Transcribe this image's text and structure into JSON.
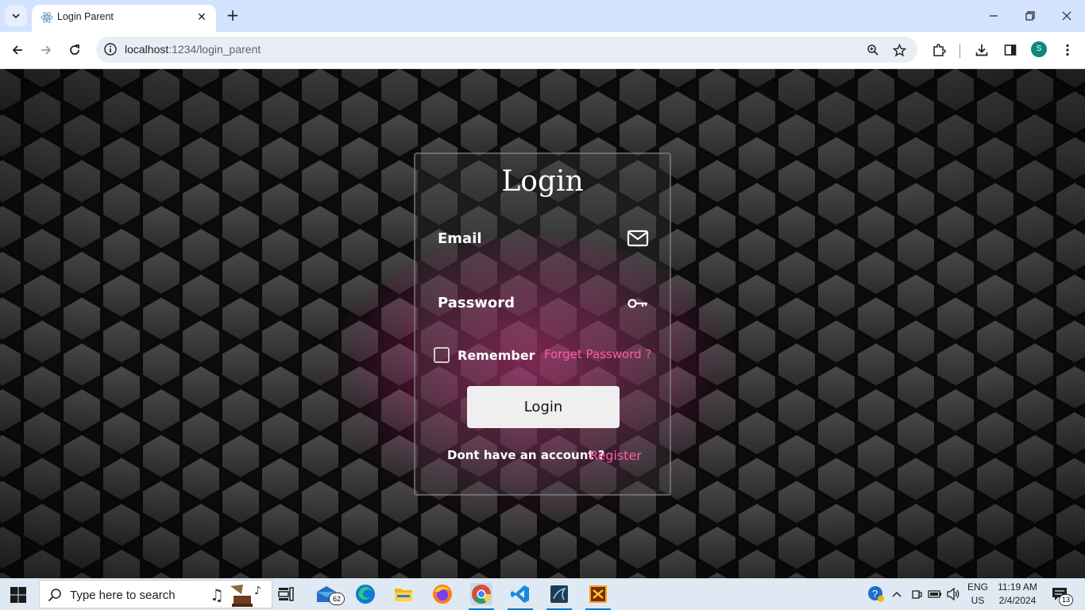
{
  "browser": {
    "tab_title": "Login Parent",
    "url_host": "localhost",
    "url_rest": ":1234/login_parent",
    "profile_initial": "S"
  },
  "login": {
    "title": "Login",
    "email_label": "Email",
    "password_label": "Password",
    "remember_label": "Remember",
    "remember_checked": false,
    "forget_link": "Forget Password ?",
    "button_label": "Login",
    "no_account_text": "Dont have an account ?",
    "register_link": "Register",
    "accent_color": "#ff5aa8"
  },
  "taskbar": {
    "search_placeholder": "Type here to search",
    "mail_badge": "62",
    "lang_line1": "ENG",
    "lang_line2": "US",
    "time": "11:19 AM",
    "date": "2/4/2024",
    "notification_count": "13"
  }
}
